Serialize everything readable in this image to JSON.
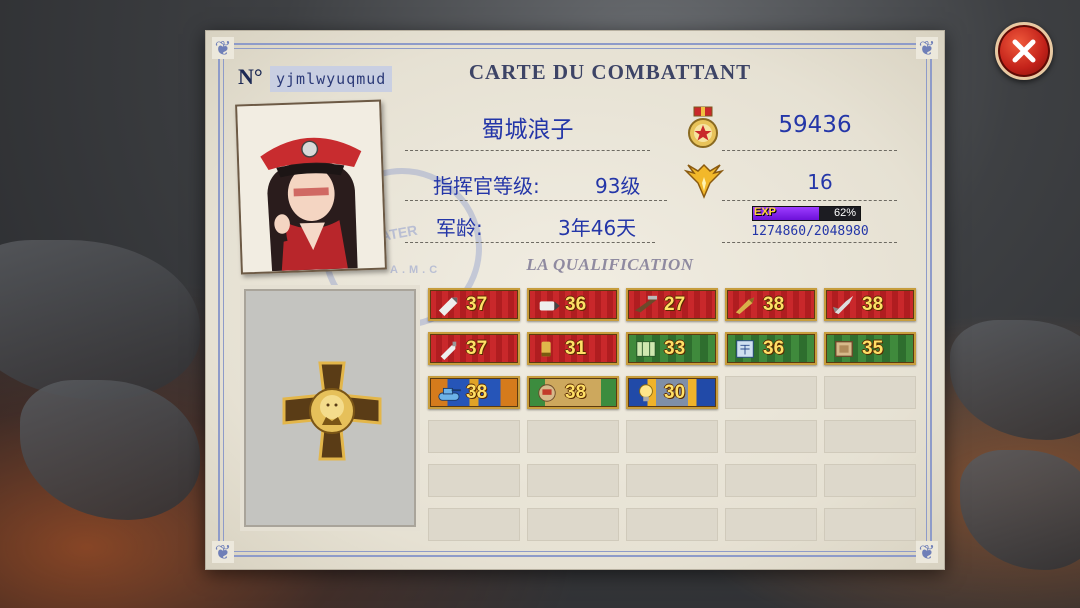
{
  "header": {
    "serial_label": "N°",
    "serial_value": "yjmlwyuqmud",
    "title": "CARTE DU COMBATTANT"
  },
  "close_button": {
    "icon": "close-icon"
  },
  "profile": {
    "name": "蜀城浪子",
    "power": "59436",
    "commander_level_label": "指挥官等级:",
    "commander_level_value": "93级",
    "military_rank": "16",
    "service_age_label": "军龄:",
    "service_age_value": "3年46天",
    "exp_tag": "EXP",
    "exp_percent_text": "62%",
    "exp_fraction": 0.62,
    "exp_text": "1274860/2048980"
  },
  "stamp": {
    "text1": "WATER",
    "text2": "A.M.C"
  },
  "qualification_title": "LA QUALIFICATION",
  "badges": [
    {
      "icon": "bullet-icon",
      "value": "37",
      "style": "red"
    },
    {
      "icon": "shell-icon",
      "value": "36",
      "style": "red"
    },
    {
      "icon": "rifle-icon",
      "value": "27",
      "style": "red"
    },
    {
      "icon": "cannon-shell-icon",
      "value": "38",
      "style": "red"
    },
    {
      "icon": "rocket-icon",
      "value": "38",
      "style": "red"
    },
    {
      "icon": "bottle-icon",
      "value": "37",
      "style": "red"
    },
    {
      "icon": "cartridge-icon",
      "value": "31",
      "style": "red"
    },
    {
      "icon": "map-icon",
      "value": "33",
      "style": "green"
    },
    {
      "icon": "blueprint-icon",
      "value": "36",
      "style": "green"
    },
    {
      "icon": "crate-icon",
      "value": "35",
      "style": "green"
    },
    {
      "icon": "tank-icon",
      "value": "38",
      "style": "blue"
    },
    {
      "icon": "turret-icon",
      "value": "38",
      "style": "tan"
    },
    {
      "icon": "lightbulb-icon",
      "value": "30",
      "style": "navy"
    }
  ],
  "colors": {
    "text_blue": "#2436a8",
    "frame_blue": "#8e9bc9",
    "exp_purple": "#8a2be2",
    "badge_gold": "#ffe066"
  }
}
